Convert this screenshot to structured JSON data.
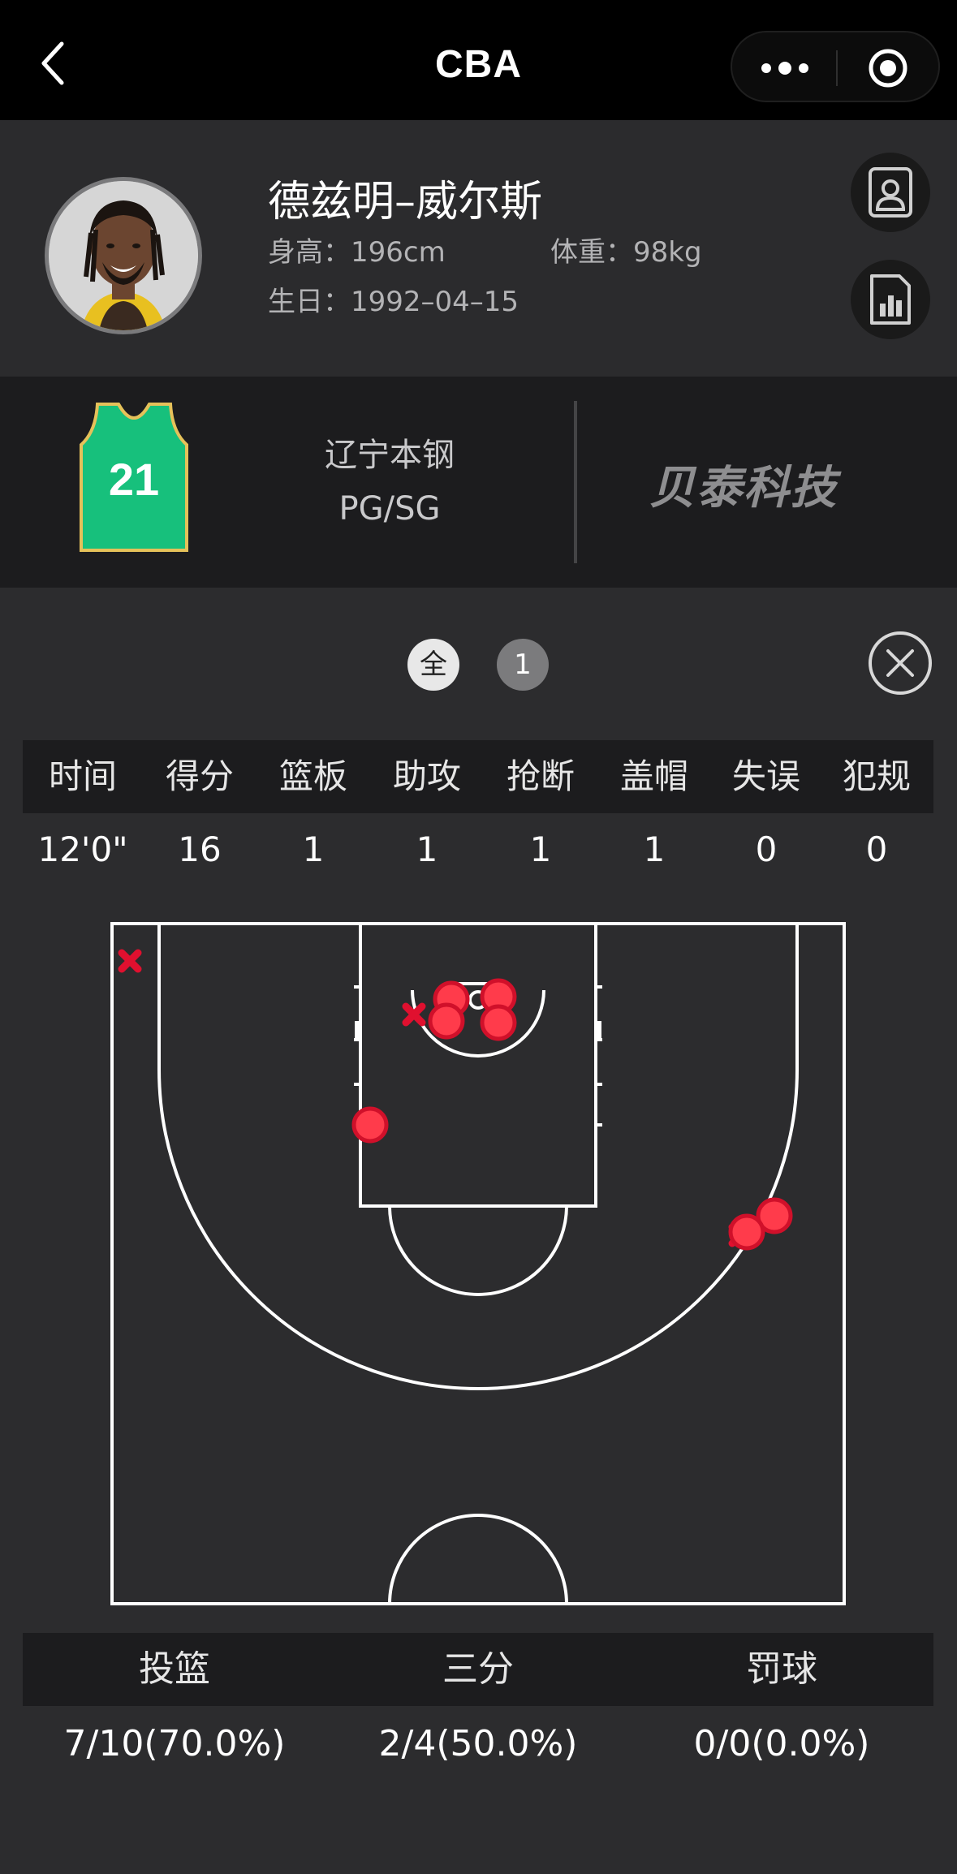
{
  "nav": {
    "title": "CBA"
  },
  "player": {
    "name": "德兹明–威尔斯",
    "height_label": "身高：",
    "height": "196cm",
    "weight_label": "体重：",
    "weight": "98kg",
    "birthday_label": "生日：",
    "birthday": "1992–04–15"
  },
  "team": {
    "name": "辽宁本钢",
    "position": "PG/SG",
    "jersey_number": "21",
    "brand_logo": "贝泰科技"
  },
  "period_filter": {
    "options": [
      "全",
      "1"
    ],
    "selected": "全"
  },
  "stats": {
    "headers": [
      "时间",
      "得分",
      "篮板",
      "助攻",
      "抢断",
      "盖帽",
      "失误",
      "犯规"
    ],
    "values": [
      "12'0\"",
      "16",
      "1",
      "1",
      "1",
      "1",
      "0",
      "0"
    ]
  },
  "shot_chart": {
    "made_shots": 7,
    "missed_shots": 3,
    "made_color": "#ff3b4b",
    "missed_color": "#e0102f"
  },
  "shooting": {
    "headers": [
      "投篮",
      "三分",
      "罚球"
    ],
    "values": [
      "7/10(70.0%)",
      "2/4(50.0%)",
      "0/0(0.0%)"
    ]
  },
  "colors": {
    "nav_bg": "#000000",
    "page_bg": "#2c2c2e",
    "band_bg": "#1c1c1e",
    "court_line": "#ffffff",
    "jersey": "#17c07c"
  },
  "icons": [
    "back-arrow-icon",
    "more-dots-icon",
    "target-circle-icon",
    "profile-card-icon",
    "stats-report-icon",
    "close-icon"
  ]
}
